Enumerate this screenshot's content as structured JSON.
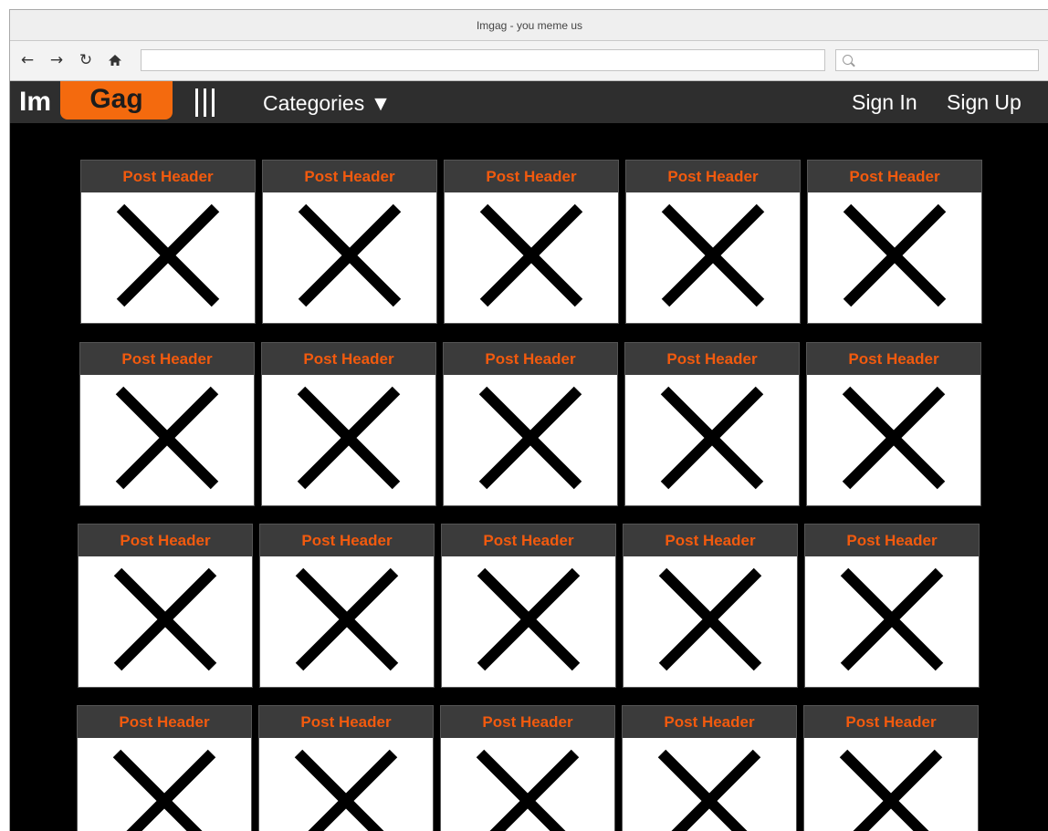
{
  "window": {
    "title": "Imgag - you meme us"
  },
  "browser": {
    "back_icon": "arrow-left-icon",
    "forward_icon": "arrow-right-icon",
    "reload_icon": "reload-icon",
    "home_icon": "home-icon",
    "address_value": "",
    "search_value": "",
    "search_icon": "search-icon"
  },
  "header": {
    "logo_part1": "Im",
    "logo_part2": "Gag",
    "menu_icon": "vertical-bars-icon",
    "categories_label": "Categories ▼",
    "sign_in_label": "Sign In",
    "sign_up_label": "Sign Up"
  },
  "colors": {
    "accent": "#f46a0e",
    "header_bg": "#2e2e2e",
    "content_bg": "#000000",
    "post_header_text": "#f25a0e"
  },
  "posts": [
    {
      "header": "Post Header",
      "image_icon": "image-placeholder-icon"
    },
    {
      "header": "Post Header",
      "image_icon": "image-placeholder-icon"
    },
    {
      "header": "Post Header",
      "image_icon": "image-placeholder-icon"
    },
    {
      "header": "Post Header",
      "image_icon": "image-placeholder-icon"
    },
    {
      "header": "Post Header",
      "image_icon": "image-placeholder-icon"
    },
    {
      "header": "Post Header",
      "image_icon": "image-placeholder-icon"
    },
    {
      "header": "Post Header",
      "image_icon": "image-placeholder-icon"
    },
    {
      "header": "Post Header",
      "image_icon": "image-placeholder-icon"
    },
    {
      "header": "Post Header",
      "image_icon": "image-placeholder-icon"
    },
    {
      "header": "Post Header",
      "image_icon": "image-placeholder-icon"
    },
    {
      "header": "Post Header",
      "image_icon": "image-placeholder-icon"
    },
    {
      "header": "Post Header",
      "image_icon": "image-placeholder-icon"
    },
    {
      "header": "Post Header",
      "image_icon": "image-placeholder-icon"
    },
    {
      "header": "Post Header",
      "image_icon": "image-placeholder-icon"
    },
    {
      "header": "Post Header",
      "image_icon": "image-placeholder-icon"
    },
    {
      "header": "Post Header",
      "image_icon": "image-placeholder-icon"
    },
    {
      "header": "Post Header",
      "image_icon": "image-placeholder-icon"
    },
    {
      "header": "Post Header",
      "image_icon": "image-placeholder-icon"
    },
    {
      "header": "Post Header",
      "image_icon": "image-placeholder-icon"
    },
    {
      "header": "Post Header",
      "image_icon": "image-placeholder-icon"
    }
  ]
}
